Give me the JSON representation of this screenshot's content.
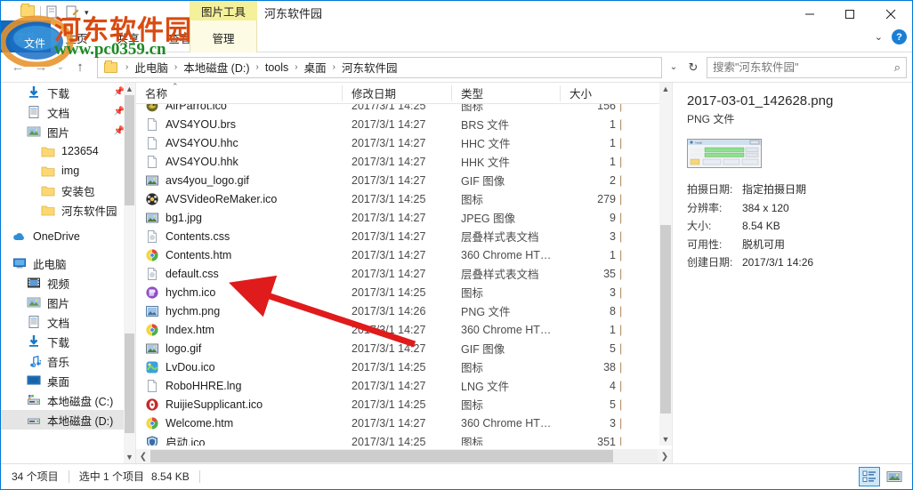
{
  "window": {
    "title": "河东软件园",
    "controls": {
      "minimize": "minimize",
      "maximize": "maximize",
      "close": "close"
    },
    "help": "?",
    "ribbon_collapse": "⌄"
  },
  "quick_access": {
    "items": [
      "new-folder-icon",
      "properties-icon",
      "rename-icon"
    ],
    "dropdown": "▾"
  },
  "ribbon": {
    "file_tab": "文件",
    "tabs": [
      "主页",
      "共享",
      "查看"
    ],
    "contextual": {
      "group_title": "图片工具",
      "tab": "管理"
    }
  },
  "address_bar": {
    "back": "←",
    "forward": "→",
    "recent": "⌄",
    "up": "↑",
    "crumbs": [
      "此电脑",
      "本地磁盘 (D:)",
      "tools",
      "桌面",
      "河东软件园"
    ],
    "crumb_separator": "›",
    "path_dropdown": "⌄",
    "refresh": "↻"
  },
  "search": {
    "placeholder": "搜索\"河东软件园\"",
    "value": "",
    "icon": "search-icon"
  },
  "sidebar": {
    "quick_items": [
      {
        "label": "下载",
        "icon": "download-icon",
        "pinned": true
      },
      {
        "label": "文档",
        "icon": "document-icon",
        "pinned": true
      },
      {
        "label": "图片",
        "icon": "pictures-icon",
        "pinned": true
      },
      {
        "label": "123654",
        "icon": "folder-icon",
        "pinned": false
      },
      {
        "label": "img",
        "icon": "folder-icon",
        "pinned": false
      },
      {
        "label": "安装包",
        "icon": "folder-icon",
        "pinned": false
      },
      {
        "label": "河东软件园",
        "icon": "folder-icon",
        "pinned": false
      }
    ],
    "onedrive": {
      "label": "OneDrive",
      "icon": "onedrive-cloud-icon"
    },
    "thispc": {
      "label": "此电脑",
      "icon": "computer-icon"
    },
    "thispc_children": [
      {
        "label": "视频",
        "icon": "video-icon"
      },
      {
        "label": "图片",
        "icon": "pictures-icon"
      },
      {
        "label": "文档",
        "icon": "document-icon"
      },
      {
        "label": "下载",
        "icon": "download-icon"
      },
      {
        "label": "音乐",
        "icon": "music-icon"
      },
      {
        "label": "桌面",
        "icon": "desktop-icon"
      },
      {
        "label": "本地磁盘 (C:)",
        "icon": "system-drive-icon"
      },
      {
        "label": "本地磁盘 (D:)",
        "icon": "drive-icon",
        "selected": true
      }
    ]
  },
  "filelist": {
    "columns": [
      "名称",
      "修改日期",
      "类型",
      "大小"
    ],
    "sort_indicator": "⌃",
    "size_unit_clipped": "|",
    "rows": [
      {
        "name": "AirParrot.ico",
        "date": "2017/3/1 14:25",
        "type": "图标",
        "size": "156",
        "icon": "ico-airparrot",
        "clipped": true
      },
      {
        "name": "AVS4YOU.brs",
        "date": "2017/3/1 14:27",
        "type": "BRS 文件",
        "size": "1",
        "icon": "file-blank-icon"
      },
      {
        "name": "AVS4YOU.hhc",
        "date": "2017/3/1 14:27",
        "type": "HHC 文件",
        "size": "1",
        "icon": "file-blank-icon"
      },
      {
        "name": "AVS4YOU.hhk",
        "date": "2017/3/1 14:27",
        "type": "HHK 文件",
        "size": "1",
        "icon": "file-blank-icon"
      },
      {
        "name": "avs4you_logo.gif",
        "date": "2017/3/1 14:27",
        "type": "GIF 图像",
        "size": "2",
        "icon": "image-icon"
      },
      {
        "name": "AVSVideoReMaker.ico",
        "date": "2017/3/1 14:25",
        "type": "图标",
        "size": "279",
        "icon": "ico-film-icon"
      },
      {
        "name": "bg1.jpg",
        "date": "2017/3/1 14:27",
        "type": "JPEG 图像",
        "size": "9",
        "icon": "image-icon"
      },
      {
        "name": "Contents.css",
        "date": "2017/3/1 14:27",
        "type": "层叠样式表文档",
        "size": "3",
        "icon": "css-file-icon"
      },
      {
        "name": "Contents.htm",
        "date": "2017/3/1 14:27",
        "type": "360 Chrome HT…",
        "size": "1",
        "icon": "chrome-icon"
      },
      {
        "name": "default.css",
        "date": "2017/3/1 14:27",
        "type": "层叠样式表文档",
        "size": "35",
        "icon": "css-file-icon"
      },
      {
        "name": "hychm.ico",
        "date": "2017/3/1 14:25",
        "type": "图标",
        "size": "3",
        "icon": "ico-purple-icon"
      },
      {
        "name": "hychm.png",
        "date": "2017/3/1 14:26",
        "type": "PNG 文件",
        "size": "8",
        "icon": "png-icon"
      },
      {
        "name": "Index.htm",
        "date": "2017/3/1 14:27",
        "type": "360 Chrome HT…",
        "size": "1",
        "icon": "chrome-icon"
      },
      {
        "name": "logo.gif",
        "date": "2017/3/1 14:27",
        "type": "GIF 图像",
        "size": "5",
        "icon": "image-icon"
      },
      {
        "name": "LvDou.ico",
        "date": "2017/3/1 14:25",
        "type": "图标",
        "size": "38",
        "icon": "ico-lvdou-icon"
      },
      {
        "name": "RoboHHRE.lng",
        "date": "2017/3/1 14:27",
        "type": "LNG 文件",
        "size": "4",
        "icon": "file-blank-icon"
      },
      {
        "name": "RuijieSupplicant.ico",
        "date": "2017/3/1 14:25",
        "type": "图标",
        "size": "5",
        "icon": "ico-ruijie-icon"
      },
      {
        "name": "Welcome.htm",
        "date": "2017/3/1 14:27",
        "type": "360 Chrome HT…",
        "size": "3",
        "icon": "chrome-icon"
      },
      {
        "name": "启动.ico",
        "date": "2017/3/1 14:25",
        "type": "图标",
        "size": "351",
        "icon": "ico-shield-icon"
      }
    ]
  },
  "details_pane": {
    "filename": "2017-03-01_142628.png",
    "filetype": "PNG 文件",
    "thumbnail": "image-thumbnail",
    "properties": [
      {
        "key": "拍摄日期:",
        "value": "指定拍摄日期"
      },
      {
        "key": "分辨率:",
        "value": "384 x 120"
      },
      {
        "key": "大小:",
        "value": "8.54 KB"
      },
      {
        "key": "可用性:",
        "value": "脱机可用"
      },
      {
        "key": "创建日期:",
        "value": "2017/3/1 14:26"
      }
    ]
  },
  "status_bar": {
    "item_count": "34 个项目",
    "selection": "选中 1 个项目",
    "selection_size": "8.54 KB",
    "views": [
      {
        "name": "details-view",
        "active": true
      },
      {
        "name": "large-icons-view",
        "active": false
      }
    ]
  },
  "watermark": {
    "text": "河东软件园",
    "url": "www.pc0359.cn"
  },
  "colors": {
    "accent": "#0078d7",
    "file_tab": "#1668b8",
    "contextual_title": "#f5f09a",
    "selection": "#e5e5e5",
    "watermark_text": "#d94b12",
    "watermark_url": "#1a8a23",
    "annotation_arrow": "#e01b1b"
  }
}
